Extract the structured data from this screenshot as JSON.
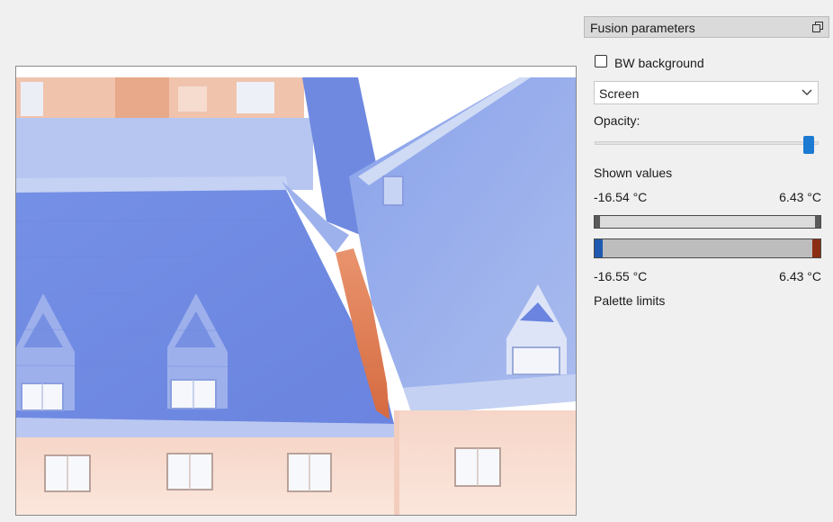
{
  "panel": {
    "title": "Fusion parameters",
    "restore_icon": "restore-window-icon"
  },
  "bw_background": {
    "label": "BW background",
    "checked": false
  },
  "blend_mode": {
    "value": "Screen",
    "chevron_icon": "chevron-down-icon"
  },
  "opacity": {
    "label": "Opacity:",
    "value": 0.98
  },
  "shown_values": {
    "label": "Shown values",
    "min": "-16.54 °C",
    "max": "6.43 °C"
  },
  "palette_limits": {
    "label": "Palette limits",
    "min": "-16.55 °C",
    "max": "6.43 °C"
  },
  "colors": {
    "accent": "#1c7ad3",
    "palette_cold": "#1f5ab0",
    "palette_hot": "#8a2d12",
    "thermal_cold": "#7e9be8",
    "thermal_warm": "#f2c4b0"
  }
}
